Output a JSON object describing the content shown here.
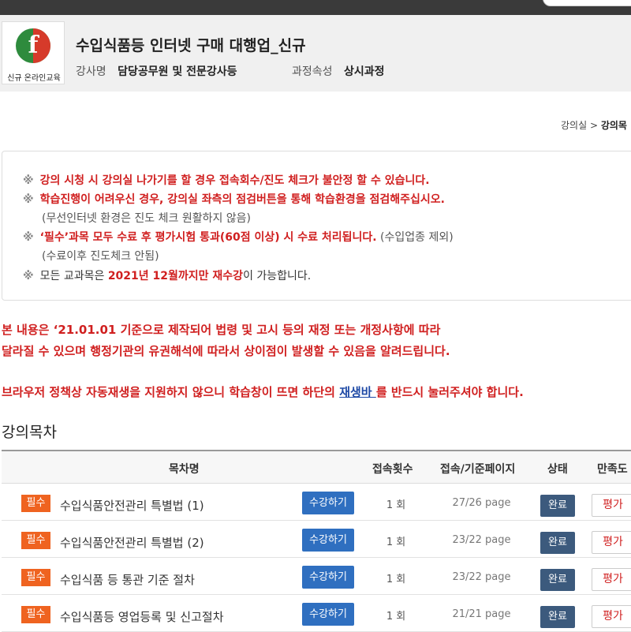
{
  "course": {
    "title": "수입식품등 인터넷 구매 대행업_신규",
    "logo_text": "신규 온라인교육",
    "instructor_label": "강사명",
    "instructor_value": "담당공무원 및 전문강사등",
    "type_label": "과정속성",
    "type_value": "상시과정"
  },
  "breadcrumb": {
    "item1": "강의실",
    "sep": ">",
    "item2": "강의목"
  },
  "notice": {
    "mark": "※",
    "l1": "강의 시청 시 강의실 나가기를 할 경우 접속회수/진도 체크가 불안정 할 수 있습니다.",
    "l2": "학습진행이 어려우신 경우, 강의실 좌측의 점검버튼을 통해 학습환경을 점검해주십시오.",
    "l3": "(무선인터넷 환경은 진도 체크 원활하지 않음)",
    "l4_red": "‘필수’과목 모두 수료 후 평가시험 통과(60점 이상) 시 수료 처리됩니다.",
    "l4_gray": " (수입업종 제외)",
    "l5": "(수료이후 진도체크 안됨)",
    "l6_a": "모든 교과목은 ",
    "l6_red": "2021년 12월까지만 재수강",
    "l6_b": "이 가능합니다."
  },
  "alerts": {
    "a1": "본 내용은 ‘21.01.01 기준으로 제작되어 법령 및 고시 등의 재정 또는 개정사항에 따라",
    "a2": "달라질 수 있으며 행정기관의 유권해석에 따라서 상이점이 발생할 수 있음을 알려드립니다.",
    "a3_pre": "브라우저 정책상 자동재생을 지원하지 않으니 학습창이 뜨면 하단의 ",
    "a3_link": "재생바 ",
    "a3_post": "를 반드시 눌러주셔야 합니다."
  },
  "toc": {
    "title": "강의목차",
    "headers": {
      "name": "목차명",
      "count": "접속횟수",
      "pages": "접속/기준페이지",
      "status": "상태",
      "rating": "만족도"
    },
    "rows": [
      {
        "tag": "필수",
        "title": "수입식품안전관리 특별법 (1)",
        "button": "수강하기",
        "count": "1 회",
        "pages": "27/26 page",
        "status": "완료",
        "rating": "평가"
      },
      {
        "tag": "필수",
        "title": "수입식품안전관리 특별법 (2)",
        "button": "수강하기",
        "count": "1 회",
        "pages": "23/22 page",
        "status": "완료",
        "rating": "평가"
      },
      {
        "tag": "필수",
        "title": "수입식품 등 통관 기준 절차",
        "button": "수강하기",
        "count": "1 회",
        "pages": "23/22 page",
        "status": "완료",
        "rating": "평가"
      },
      {
        "tag": "필수",
        "title": "수입식품등 영업등록 및 신고절차",
        "button": "수강하기",
        "count": "1 회",
        "pages": "21/21 page",
        "status": "완료",
        "rating": "평가"
      }
    ]
  }
}
